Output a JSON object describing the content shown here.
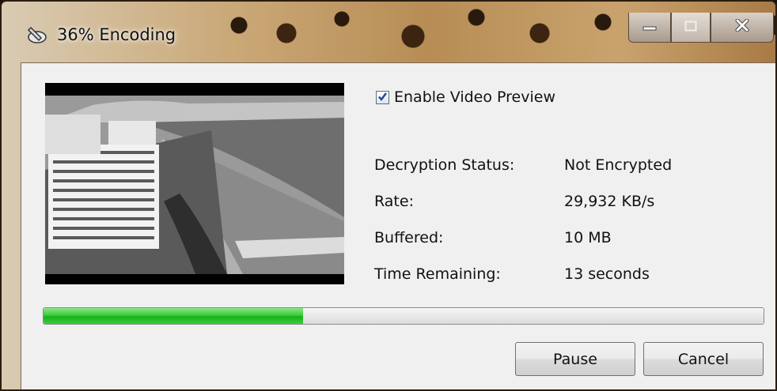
{
  "window": {
    "title": "36% Encoding",
    "app_icon": "wrench-disc-icon",
    "controls": {
      "minimize_icon": "minimize-icon",
      "maximize_icon": "maximize-icon",
      "close_icon": "close-icon"
    }
  },
  "preview": {
    "enable_label": "Enable Video Preview",
    "enabled": true
  },
  "info": [
    {
      "label": "Decryption Status:",
      "value": "Not Encrypted"
    },
    {
      "label": "Rate:",
      "value": "29,932 KB/s"
    },
    {
      "label": "Buffered:",
      "value": "10 MB"
    },
    {
      "label": "Time Remaining:",
      "value": "13 seconds"
    }
  ],
  "progress": {
    "fraction": 0.36,
    "color": "#2ec52f"
  },
  "buttons": {
    "pause": "Pause",
    "cancel": "Cancel"
  }
}
